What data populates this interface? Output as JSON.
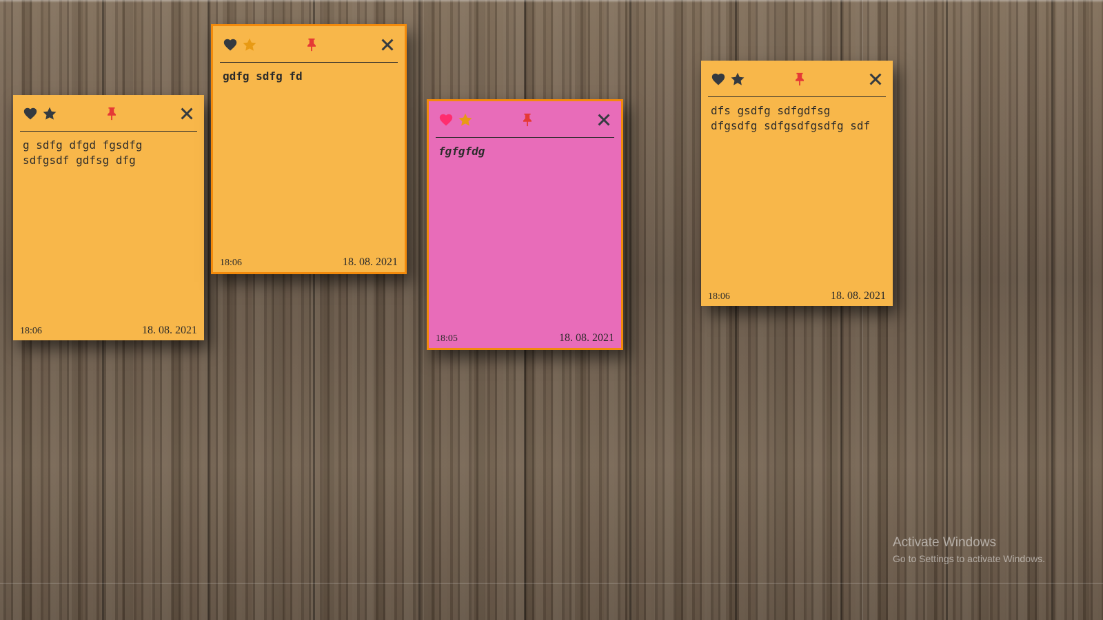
{
  "notes": [
    {
      "text": "g sdfg dfgd fgsdfg\nsdfgsdf gdfsg dfg",
      "time": "18:06",
      "date": "18. 08. 2021",
      "color": "#f8b74a",
      "favorited": false,
      "starred": false,
      "text_style": "normal"
    },
    {
      "text": "gdfg sdfg fd",
      "time": "18:06",
      "date": "18. 08. 2021",
      "color": "#f8b74a",
      "favorited": false,
      "starred": true,
      "text_style": "bold"
    },
    {
      "text": "fgfgfdg",
      "time": "18:05",
      "date": "18. 08. 2021",
      "color": "#e86cb9",
      "favorited": true,
      "starred": true,
      "text_style": "bold-italic"
    },
    {
      "text": "dfs gsdfg sdfgdfsg\ndfgsdfg sdfgsdfgsdfg sdf",
      "time": "18:06",
      "date": "18. 08. 2021",
      "color": "#f8b74a",
      "favorited": false,
      "starred": false,
      "text_style": "normal"
    }
  ],
  "icons": {
    "heart": "heart-icon",
    "star": "star-icon",
    "pin": "pin-icon",
    "close": "close-icon"
  },
  "colors": {
    "icon_default": "#343a40",
    "heart_active": "#ff2d6f",
    "star_active": "#e89a14",
    "pin": "#e53935",
    "selected_border": "#f28a0c"
  },
  "watermark": {
    "title": "Activate Windows",
    "subtitle": "Go to Settings to activate Windows."
  }
}
